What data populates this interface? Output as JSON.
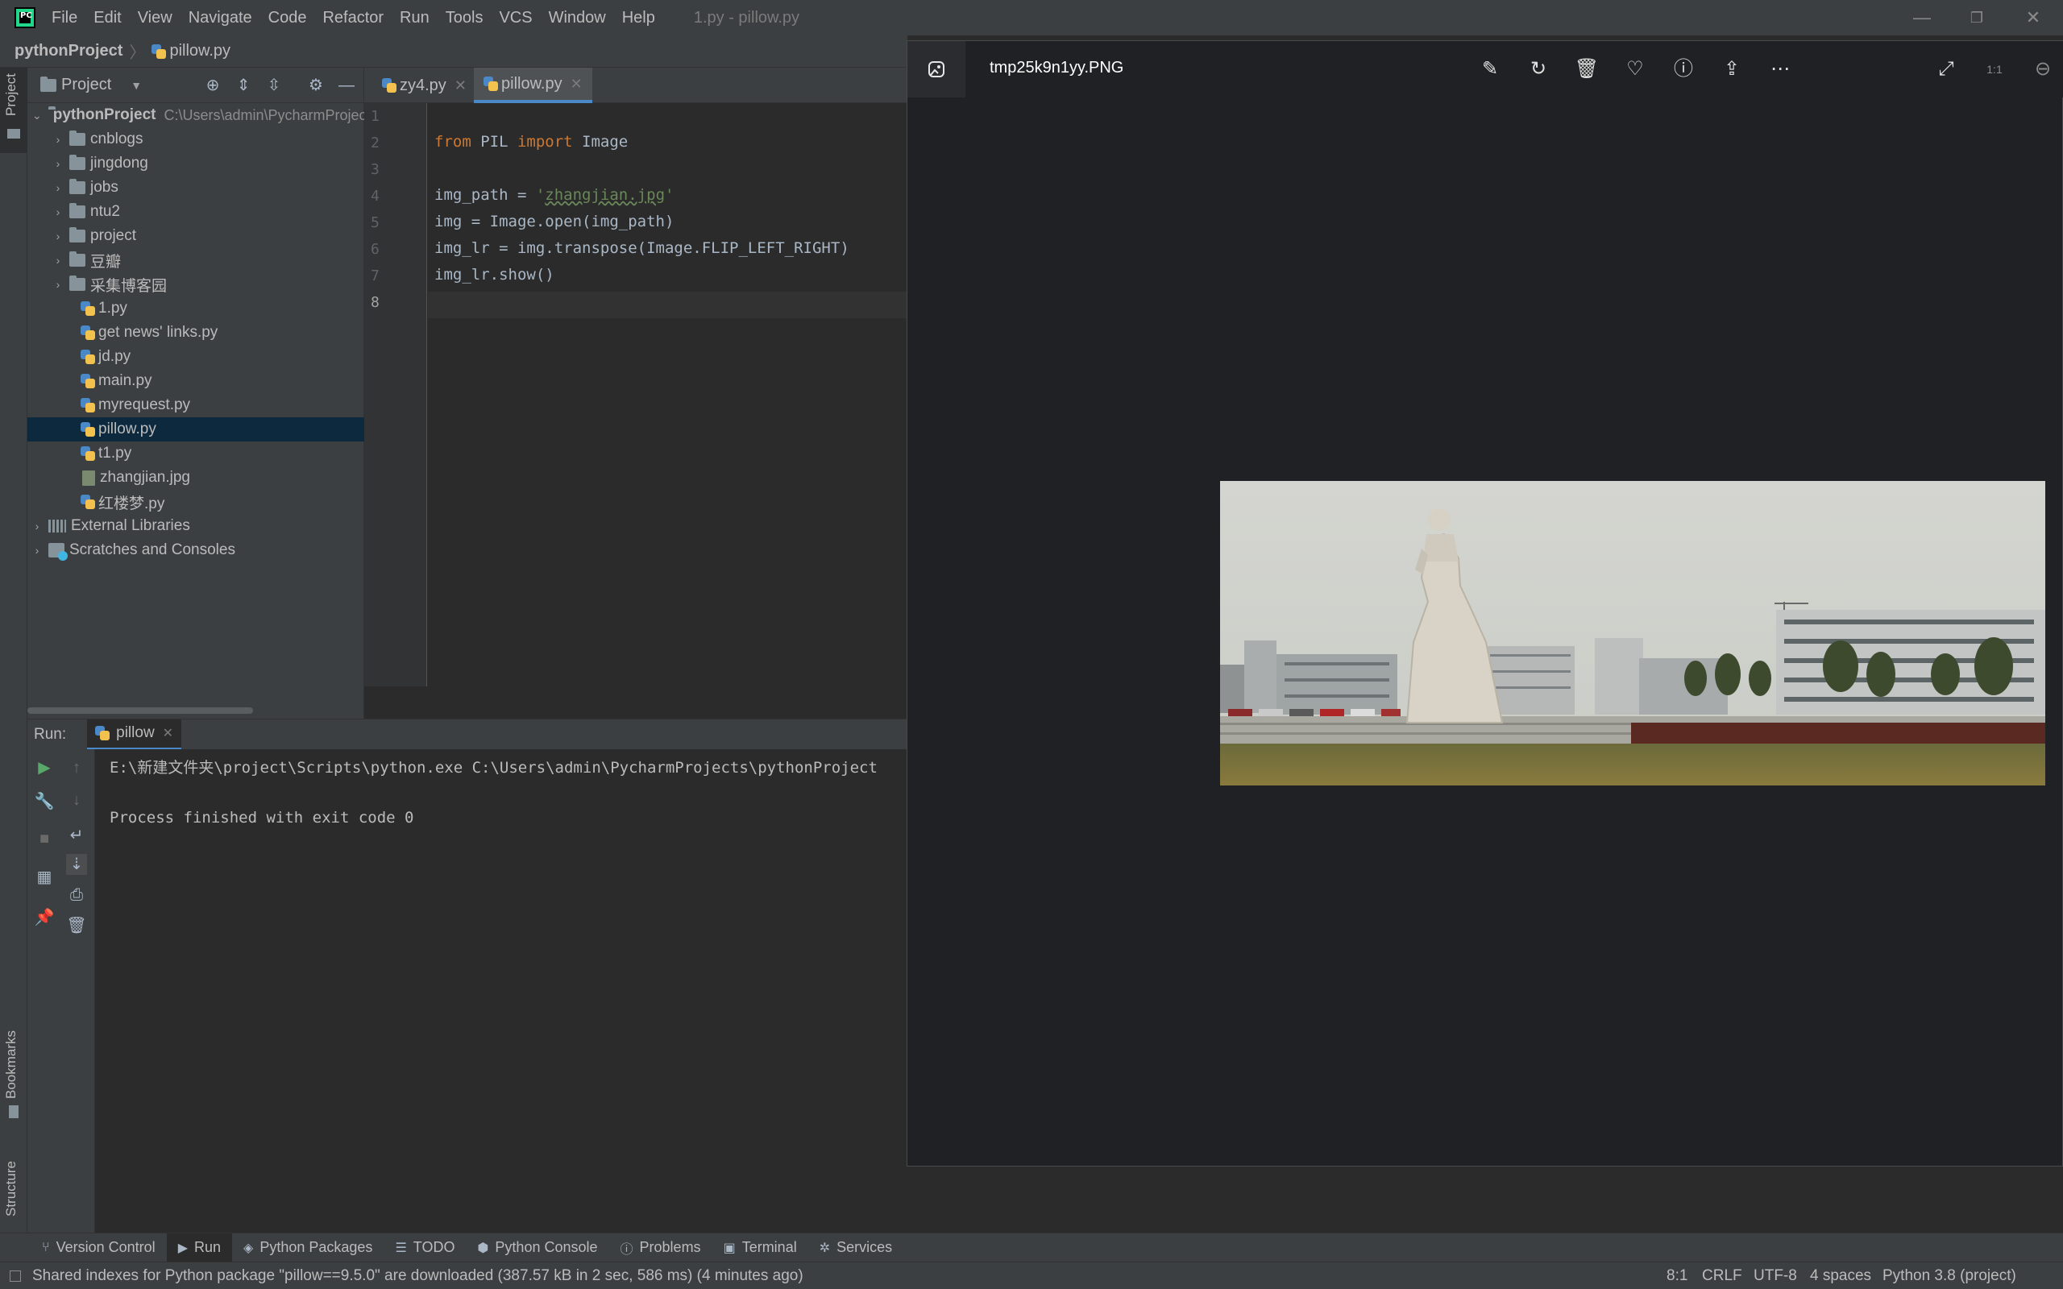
{
  "titlebar": {
    "menus": [
      "File",
      "Edit",
      "View",
      "Navigate",
      "Code",
      "Refactor",
      "Run",
      "Tools",
      "VCS",
      "Window",
      "Help"
    ],
    "window_title": "1.py - pillow.py",
    "minimize": "—",
    "restore": "❐",
    "close": "✕"
  },
  "navbar": {
    "project": "pythonProject",
    "file": "pillow.py"
  },
  "left_strip": {
    "project_label": "Project",
    "bookmarks_label": "Bookmarks",
    "structure_label": "Structure"
  },
  "project_panel": {
    "title": "Project",
    "root_name": "pythonProject",
    "root_path": "C:\\Users\\admin\\PycharmProjects\\pythonProject",
    "folders": [
      "cnblogs",
      "jingdong",
      "jobs",
      "ntu2",
      "project",
      "豆瓣",
      "采集博客园"
    ],
    "files": [
      "1.py",
      "get news' links.py",
      "jd.py",
      "main.py",
      "myrequest.py",
      "pillow.py",
      "t1.py",
      "zhangjian.jpg",
      "红楼梦.py"
    ],
    "external_libraries": "External Libraries",
    "scratches": "Scratches and Consoles"
  },
  "editor": {
    "tabs": [
      {
        "label": "zy4.py",
        "active": false
      },
      {
        "label": "pillow.py",
        "active": true
      }
    ],
    "line_numbers": [
      "1",
      "2",
      "3",
      "4",
      "5",
      "6",
      "7",
      "8"
    ],
    "code": {
      "l2_kw1": "from",
      "l2_mid": " PIL ",
      "l2_kw2": "import",
      "l2_end": " Image",
      "l4_start": "img_path = ",
      "l4_quote": "'",
      "l4_str": "zhangjian.jpg",
      "l5": "img = Image.open(img_path)",
      "l6": "img_lr = img.transpose(Image.FLIP_LEFT_RIGHT)",
      "l7": "img_lr.show()"
    }
  },
  "run_panel": {
    "label": "Run:",
    "config": "pillow",
    "lines": [
      "E:\\新建文件夹\\project\\Scripts\\python.exe C:\\Users\\admin\\PycharmProjects\\pythonProject",
      "Process finished with exit code 0"
    ]
  },
  "tool_windows": [
    "Version Control",
    "Run",
    "Python Packages",
    "TODO",
    "Python Console",
    "Problems",
    "Terminal",
    "Services"
  ],
  "status_bar": {
    "message": "Shared indexes for Python package \"pillow==9.5.0\" are downloaded (387.57 kB in 2 sec, 586 ms) (4 minutes ago)",
    "position": "8:1",
    "line_sep": "CRLF",
    "encoding": "UTF-8",
    "indent": "4 spaces",
    "interpreter": "Python 3.8 (project)"
  },
  "viewer": {
    "filename": "tmp25k9n1yy.PNG",
    "icons": [
      "edit-icon",
      "rotate-icon",
      "delete-icon",
      "favorite-icon",
      "info-icon",
      "share-icon",
      "more-icon",
      "fullscreen-icon",
      "actual-size-icon",
      "zoom-out-icon"
    ],
    "more": "⋯",
    "actual_size": "1:1"
  },
  "colors": {
    "accent": "#4a88c7",
    "selection": "#0d293e",
    "keyword": "#cc7832",
    "string": "#6a8759"
  }
}
